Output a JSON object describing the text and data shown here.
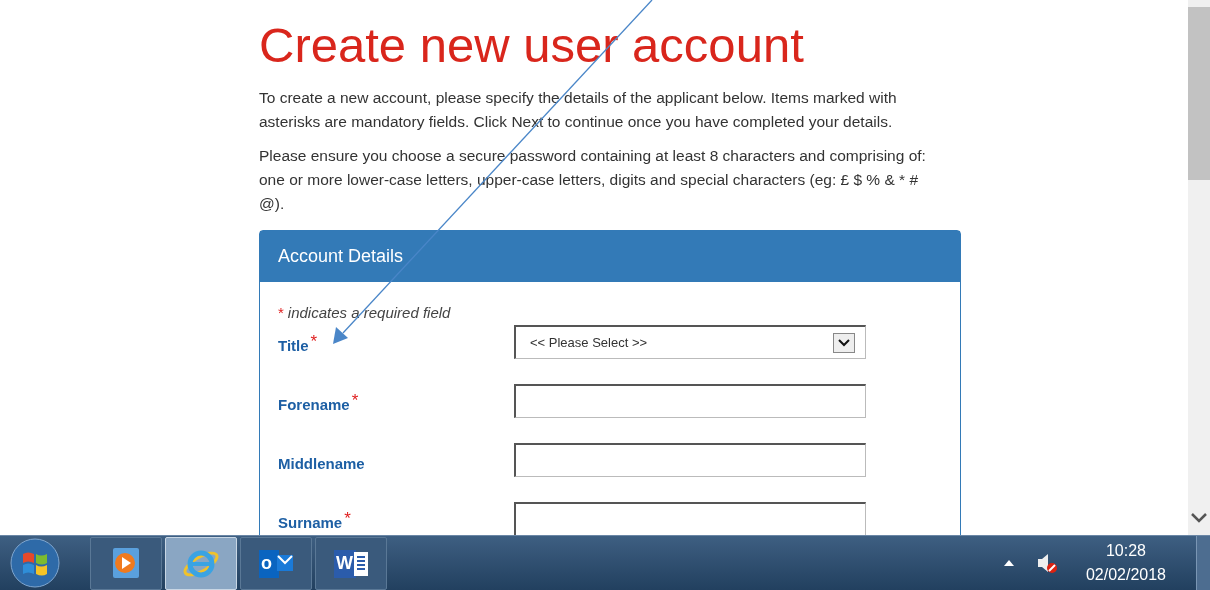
{
  "page": {
    "heading": "Create new user account",
    "paragraphs": [
      "To create a new account, please specify the details of the applicant below. Items marked with asterisks are mandatory fields. Click Next to continue once you have completed your details.",
      "Please ensure you choose a secure password containing at least 8 characters and comprising of: one or more lower-case letters, upper-case letters, digits and special characters (eg: £ $ % & * # @)."
    ]
  },
  "panel": {
    "title": "Account Details",
    "required_note": "indicates a required field",
    "required_mark": "*",
    "fields": [
      {
        "label": "Title",
        "kind": "select",
        "value": "<< Please Select >>",
        "required": true
      },
      {
        "label": "Forename",
        "kind": "text",
        "required": true
      },
      {
        "label": "Middlename",
        "kind": "text",
        "required": false
      },
      {
        "label": "Surname",
        "kind": "text",
        "required": true
      }
    ]
  },
  "taskbar": {
    "apps": [
      {
        "kind": "media",
        "selected": false
      },
      {
        "kind": "browser",
        "selected": true
      },
      {
        "kind": "mail",
        "letter": "o",
        "selected": false
      },
      {
        "kind": "word",
        "letter": "W",
        "selected": false
      }
    ],
    "time": "10:28",
    "date": "02/02/2018"
  }
}
